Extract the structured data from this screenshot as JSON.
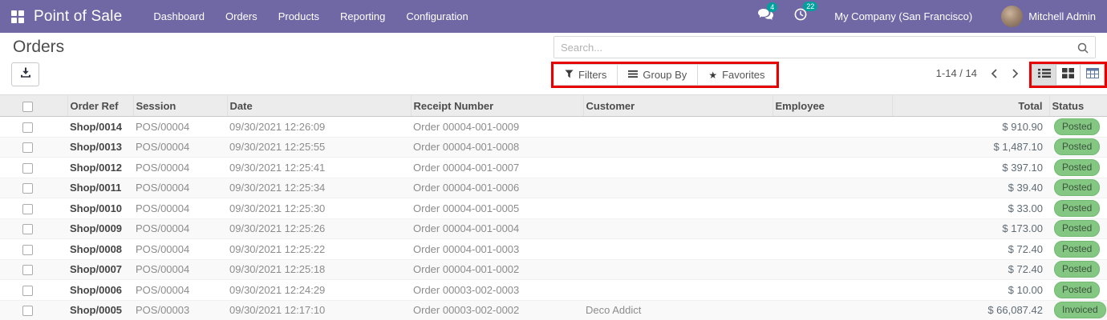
{
  "navbar": {
    "app_name": "Point of Sale",
    "menu_items": [
      "Dashboard",
      "Orders",
      "Products",
      "Reporting",
      "Configuration"
    ],
    "messages_badge": "4",
    "activities_badge": "22",
    "company_name": "My Company (San Francisco)",
    "user_name": "Mitchell Admin"
  },
  "control_panel": {
    "page_title": "Orders",
    "search_placeholder": "Search...",
    "filters_label": "Filters",
    "group_by_label": "Group By",
    "favorites_label": "Favorites",
    "favorites_star": "★",
    "pager_text": "1-14 / 14"
  },
  "table": {
    "headers": {
      "order_ref": "Order Ref",
      "session": "Session",
      "date": "Date",
      "receipt": "Receipt Number",
      "customer": "Customer",
      "employee": "Employee",
      "total": "Total",
      "status": "Status"
    },
    "rows": [
      {
        "order_ref": "Shop/0014",
        "session": "POS/00004",
        "date": "09/30/2021 12:26:09",
        "receipt": "Order 00004-001-0009",
        "customer": "",
        "employee": "",
        "total": "$ 910.90",
        "status": "Posted"
      },
      {
        "order_ref": "Shop/0013",
        "session": "POS/00004",
        "date": "09/30/2021 12:25:55",
        "receipt": "Order 00004-001-0008",
        "customer": "",
        "employee": "",
        "total": "$ 1,487.10",
        "status": "Posted"
      },
      {
        "order_ref": "Shop/0012",
        "session": "POS/00004",
        "date": "09/30/2021 12:25:41",
        "receipt": "Order 00004-001-0007",
        "customer": "",
        "employee": "",
        "total": "$ 397.10",
        "status": "Posted"
      },
      {
        "order_ref": "Shop/0011",
        "session": "POS/00004",
        "date": "09/30/2021 12:25:34",
        "receipt": "Order 00004-001-0006",
        "customer": "",
        "employee": "",
        "total": "$ 39.40",
        "status": "Posted"
      },
      {
        "order_ref": "Shop/0010",
        "session": "POS/00004",
        "date": "09/30/2021 12:25:30",
        "receipt": "Order 00004-001-0005",
        "customer": "",
        "employee": "",
        "total": "$ 33.00",
        "status": "Posted"
      },
      {
        "order_ref": "Shop/0009",
        "session": "POS/00004",
        "date": "09/30/2021 12:25:26",
        "receipt": "Order 00004-001-0004",
        "customer": "",
        "employee": "",
        "total": "$ 173.00",
        "status": "Posted"
      },
      {
        "order_ref": "Shop/0008",
        "session": "POS/00004",
        "date": "09/30/2021 12:25:22",
        "receipt": "Order 00004-001-0003",
        "customer": "",
        "employee": "",
        "total": "$ 72.40",
        "status": "Posted"
      },
      {
        "order_ref": "Shop/0007",
        "session": "POS/00004",
        "date": "09/30/2021 12:25:18",
        "receipt": "Order 00004-001-0002",
        "customer": "",
        "employee": "",
        "total": "$ 72.40",
        "status": "Posted"
      },
      {
        "order_ref": "Shop/0006",
        "session": "POS/00004",
        "date": "09/30/2021 12:24:29",
        "receipt": "Order 00003-002-0003",
        "customer": "",
        "employee": "",
        "total": "$ 10.00",
        "status": "Posted"
      },
      {
        "order_ref": "Shop/0005",
        "session": "POS/00003",
        "date": "09/30/2021 12:17:10",
        "receipt": "Order 00003-002-0002",
        "customer": "Deco Addict",
        "employee": "",
        "total": "$ 66,087.42",
        "status": "Invoiced"
      }
    ]
  },
  "colors": {
    "navbar_bg": "#7067a5",
    "nav_badge_teal": "#00a09d",
    "status_badge_bg": "#83c783",
    "status_badge_text": "#3c523c",
    "annotation_red": "#e60000",
    "table_header_bg": "#ececec"
  }
}
